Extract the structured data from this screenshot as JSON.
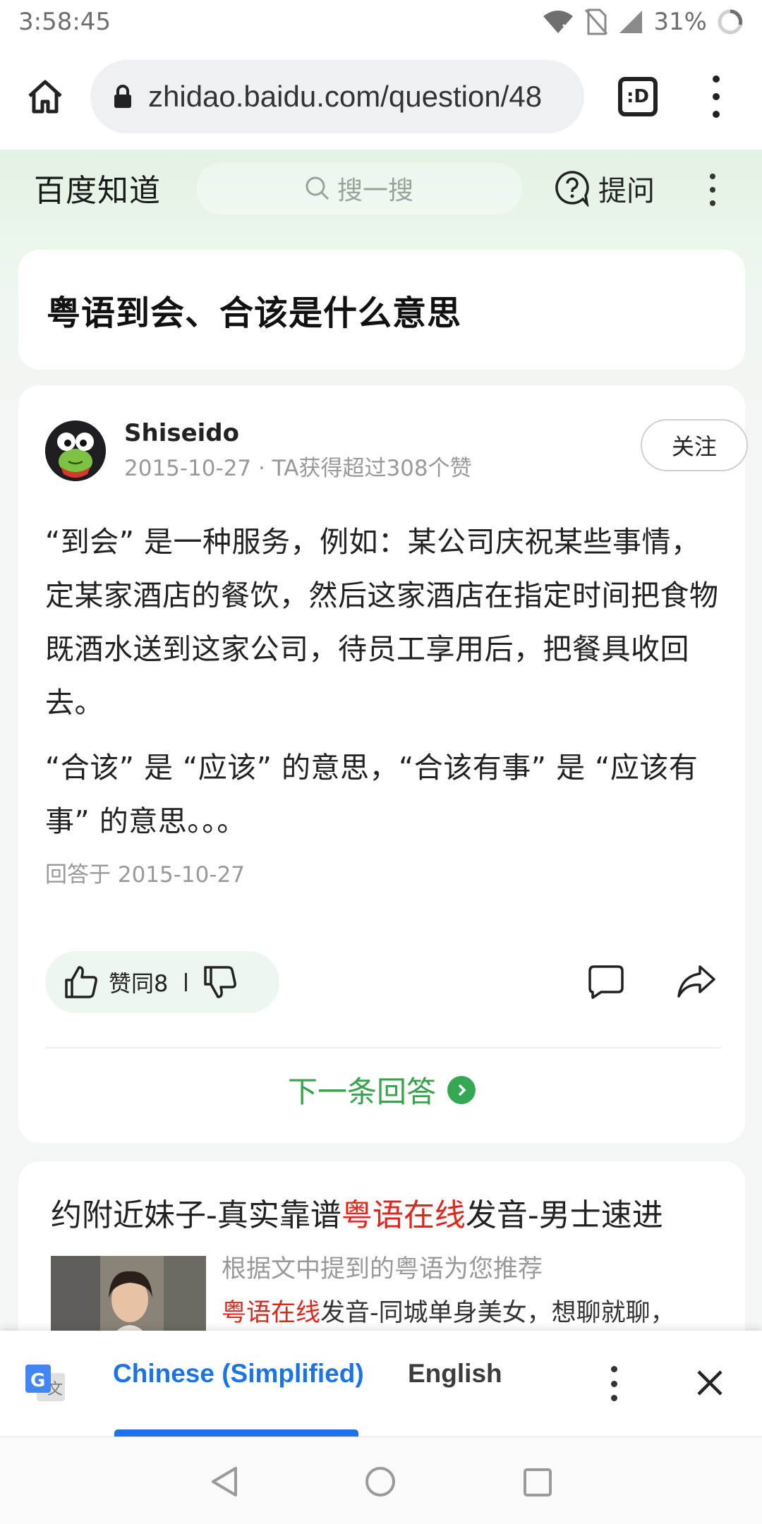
{
  "status_bar": {
    "time": "3:58:45",
    "battery": "31%",
    "icons": [
      "wifi-icon",
      "no-sim-icon",
      "signal-icon",
      "battery-icon"
    ]
  },
  "browser": {
    "url": "zhidao.baidu.com/question/48",
    "tabs_label": ":D",
    "icons": [
      "home-icon",
      "lock-icon",
      "tab-switcher-icon",
      "menu-icon"
    ]
  },
  "site_header": {
    "logo": "百度知道",
    "search_placeholder": "搜一搜",
    "ask_label": "提问",
    "icons": [
      "search-icon",
      "question-icon",
      "more-icon"
    ]
  },
  "question": {
    "title": "粤语到会、合该是什么意思"
  },
  "answer": {
    "author": "Shiseido",
    "meta": "2015-10-27 · TA获得超过308个赞",
    "follow_label": "关注",
    "paragraphs": [
      "“到会” 是一种服务，例如：某公司庆祝某些事情，定某家酒店的餐饮，然后这家酒店在指定时间把食物既酒水送到这家公司，待员工享用后，把餐具收回去。",
      "“合该” 是 “应该” 的意思，“合该有事” 是 “应该有事” 的意思。。。"
    ],
    "answered_at": "回答于 2015-10-27",
    "vote_label": "赞同8",
    "next_label": "下一条回答",
    "icons": [
      "thumbs-up-icon",
      "thumbs-down-icon",
      "comment-icon",
      "share-icon",
      "chevron-right-icon"
    ]
  },
  "ad": {
    "title_pre": "约附近妹子-真实靠谱",
    "title_highlight": "粤语在线",
    "title_post": "发音-男士速进",
    "subtitle": "根据文中提到的粤语为您推荐",
    "desc_highlight": "粤语在线",
    "desc_rest": "发音-同城单身美女，想聊就聊，"
  },
  "translate_bar": {
    "source_lang": "Chinese (Simplified)",
    "target_lang": "English",
    "icons": [
      "google-translate-icon",
      "more-icon",
      "close-icon"
    ]
  },
  "nav": {
    "icons": [
      "back-icon",
      "home-circle-icon",
      "recents-icon"
    ]
  },
  "colors": {
    "accent_green": "#39a24a",
    "highlight_red": "#e1251b",
    "translate_blue": "#1a73e8"
  }
}
